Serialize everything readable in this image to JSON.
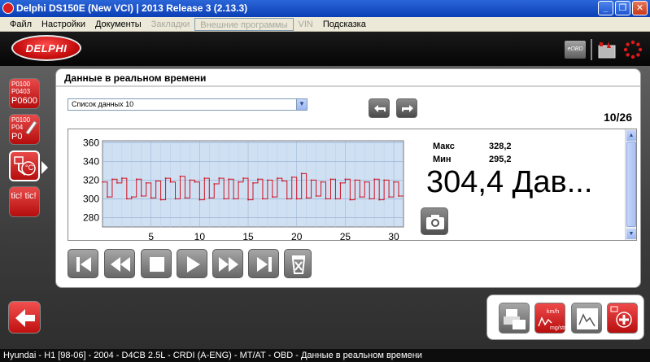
{
  "window": {
    "title": "Delphi DS150E (New VCI) | 2013 Release 3 (2.13.3)",
    "min_glyph": "_",
    "max_glyph": "❐",
    "close_glyph": "✕"
  },
  "menu": {
    "items": [
      {
        "label": "Файл",
        "state": "enabled"
      },
      {
        "label": "Настройки",
        "state": "enabled"
      },
      {
        "label": "Документы",
        "state": "enabled"
      },
      {
        "label": "Закладки",
        "state": "disabled"
      },
      {
        "label": "Внешние программы",
        "state": "disabled-boxed"
      },
      {
        "label": "VIN",
        "state": "disabled"
      },
      {
        "label": "Подсказка",
        "state": "enabled"
      }
    ]
  },
  "header": {
    "logo_text": "DELPHI",
    "eobd_label": "eOBD"
  },
  "sidebar": {
    "dtc_read_codes": [
      "P0100",
      "P0403",
      "P0600"
    ],
    "dtc_clear_codes": [
      "P0100",
      "P04",
      "P0"
    ],
    "livedata_label": "°C",
    "tic_label": "tic! tic!"
  },
  "panel": {
    "title": "Данные в реальном времени",
    "list_select_value": "Список данных 10",
    "counter": "10/26"
  },
  "live": {
    "max_label": "Макс",
    "max_value": "328,2",
    "min_label": "Мин",
    "min_value": "295,2",
    "current_value": "304,4 Дав..."
  },
  "chart_data": {
    "type": "line",
    "xticks": [
      "5",
      "10",
      "15",
      "20",
      "25",
      "30"
    ],
    "yticks": [
      "280",
      "300",
      "320",
      "340",
      "360"
    ],
    "xlim": [
      0,
      31
    ],
    "ylim": [
      270,
      362
    ],
    "grid": true,
    "background": "#cfe0f3",
    "line_color": "#d0121f",
    "x": [
      0,
      0.5,
      1.0,
      1.5,
      2.0,
      2.5,
      3.0,
      3.5,
      4.0,
      4.5,
      5.0,
      5.5,
      6.0,
      6.5,
      7.0,
      7.5,
      8.0,
      8.5,
      9.0,
      9.5,
      10.0,
      10.5,
      11.0,
      11.5,
      12.0,
      12.5,
      13.0,
      13.5,
      14.0,
      14.5,
      15.0,
      15.5,
      16.0,
      16.5,
      17.0,
      17.5,
      18.0,
      18.5,
      19.0,
      19.5,
      20.0,
      20.5,
      21.0,
      21.5,
      22.0,
      22.5,
      23.0,
      23.5,
      24.0,
      24.5,
      25.0,
      25.5,
      26.0,
      26.5,
      27.0,
      27.5,
      28.0,
      28.5,
      29.0,
      29.5,
      30.0,
      30.5
    ],
    "y": [
      318,
      302,
      321,
      317,
      322,
      300,
      302,
      321,
      303,
      317,
      301,
      319,
      299,
      322,
      318,
      300,
      324,
      301,
      320,
      318,
      299,
      322,
      301,
      316,
      322,
      300,
      321,
      300,
      318,
      322,
      299,
      317,
      321,
      300,
      320,
      302,
      322,
      319,
      300,
      323,
      300,
      327,
      301,
      320,
      303,
      318,
      300,
      321,
      300,
      317,
      321,
      299,
      320,
      302,
      318,
      300,
      321,
      299,
      320,
      302,
      318,
      303
    ]
  },
  "statusbar": {
    "text": "Hyundai - H1 [98-06] - 2004 - D4CB 2.5L - CRDI (A-ENG) - MT/AT - OBD - Данные в реальном времени"
  },
  "colors": {
    "accent_red": "#c8141a",
    "titlebar_blue": "#1a4fc7"
  }
}
